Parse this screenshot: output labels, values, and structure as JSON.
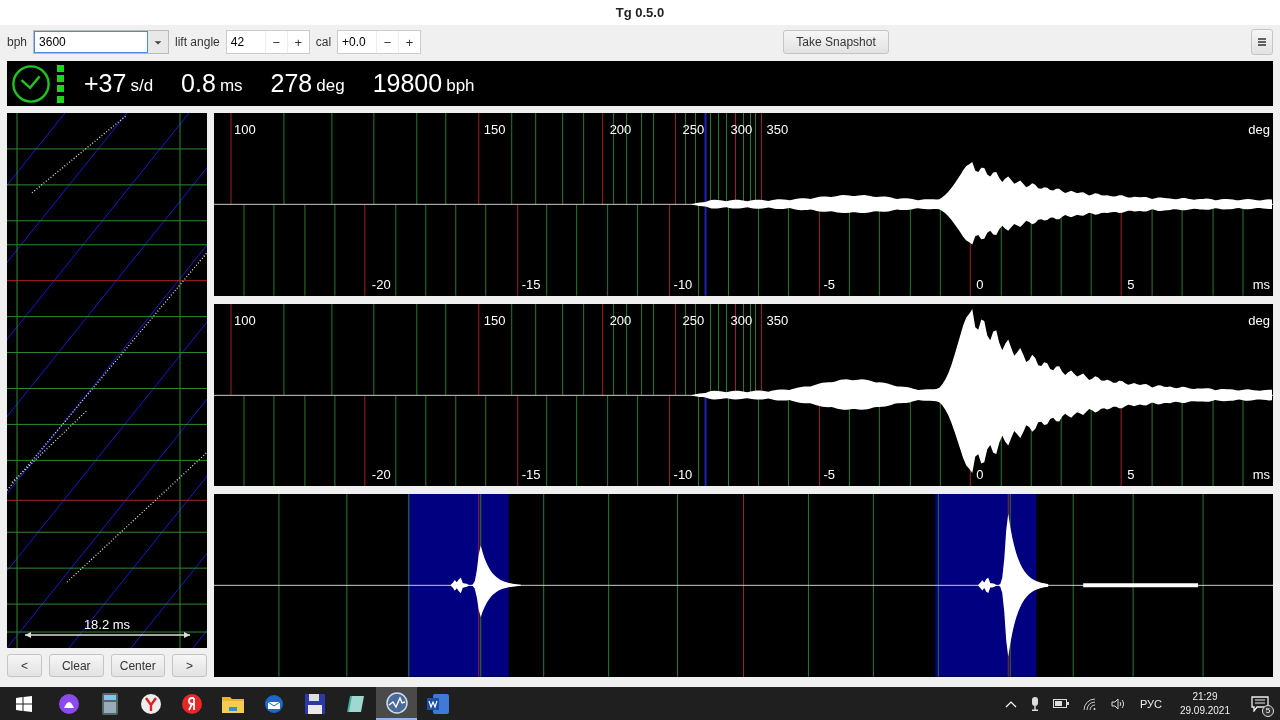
{
  "window": {
    "title": "Tg 0.5.0"
  },
  "toolbar": {
    "bph": {
      "label": "bph",
      "value": "3600"
    },
    "lift_angle": {
      "label": "lift angle",
      "value": "42",
      "minus": "−",
      "plus": "+"
    },
    "cal": {
      "label": "cal",
      "value": "+0.0",
      "minus": "−",
      "plus": "+"
    },
    "snapshot_button": "Take Snapshot"
  },
  "readout": [
    {
      "value": "+37",
      "unit": "s/d"
    },
    {
      "value": "0.8",
      "unit": "ms"
    },
    {
      "value": "278",
      "unit": "deg"
    },
    {
      "value": "19800",
      "unit": "bph"
    }
  ],
  "paper": {
    "scale_label": "18.2 ms"
  },
  "paper_buttons": [
    "<",
    "Clear",
    "Center",
    ">"
  ],
  "scopes": [
    {
      "kind": "tic",
      "deg_labels": [
        "100",
        "150",
        "200",
        "250",
        "300",
        "350"
      ],
      "deg_unit": "deg",
      "ms_labels": [
        "-20",
        "-15",
        "-10",
        "-5",
        "0",
        "5"
      ],
      "ms_unit": "ms"
    },
    {
      "kind": "toc",
      "deg_labels": [
        "100",
        "150",
        "200",
        "250",
        "300",
        "350"
      ],
      "deg_unit": "deg",
      "ms_labels": [
        "-20",
        "-15",
        "-10",
        "-5",
        "0",
        "5"
      ],
      "ms_unit": "ms"
    },
    {
      "kind": "period"
    }
  ],
  "taskbar": {
    "apps": [
      {
        "kind": "start",
        "selected": false
      },
      {
        "kind": "assistant",
        "selected": false
      },
      {
        "kind": "calculator",
        "selected": false
      },
      {
        "kind": "browser",
        "selected": false
      },
      {
        "kind": "yandex",
        "selected": false
      },
      {
        "kind": "folder",
        "selected": false
      },
      {
        "kind": "mail",
        "selected": false
      },
      {
        "kind": "floppy",
        "selected": false
      },
      {
        "kind": "notepad",
        "selected": false
      },
      {
        "kind": "tg",
        "selected": true
      },
      {
        "kind": "word",
        "selected": false
      }
    ],
    "tray": {
      "language": "РУС",
      "time": "21:29",
      "date": "29.09.2021",
      "notification_count": "5"
    }
  }
}
